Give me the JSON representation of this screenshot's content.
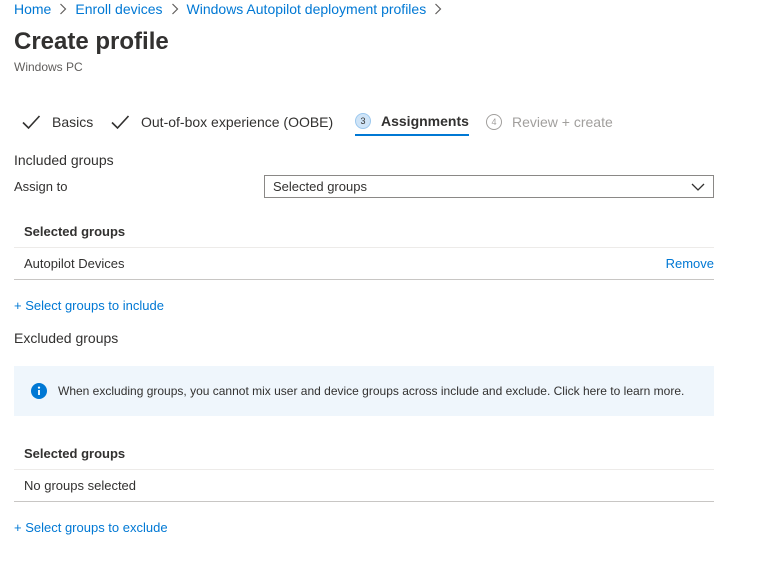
{
  "breadcrumb": [
    {
      "label": "Home"
    },
    {
      "label": "Enroll devices"
    },
    {
      "label": "Windows Autopilot deployment profiles"
    }
  ],
  "page": {
    "title": "Create profile",
    "subtitle": "Windows PC"
  },
  "wizard": {
    "steps": [
      {
        "label": "Basics",
        "state": "completed"
      },
      {
        "label": "Out-of-box experience (OOBE)",
        "state": "completed"
      },
      {
        "number": "3",
        "label": "Assignments",
        "state": "active"
      },
      {
        "number": "4",
        "label": "Review + create",
        "state": "disabled"
      }
    ]
  },
  "included": {
    "heading": "Included groups",
    "assign_label": "Assign to",
    "assign_value": "Selected groups",
    "table_header": "Selected groups",
    "rows": [
      {
        "name": "Autopilot Devices",
        "action": "Remove"
      }
    ],
    "add_link": "+ Select groups to include"
  },
  "excluded": {
    "heading": "Excluded groups",
    "info_text": "When excluding groups, you cannot mix user and device groups across include and exclude. Click here to learn more.",
    "table_header": "Selected groups",
    "empty_text": "No groups selected",
    "add_link": "+ Select groups to exclude"
  },
  "colors": {
    "accent": "#0078d4",
    "info_background": "#eff6fc",
    "text": "#323130",
    "disabled": "#a19f9d"
  },
  "icons": {
    "breadcrumb_separator": "chevron-right-icon",
    "completed_step": "checkmark-icon",
    "dropdown": "chevron-down-icon",
    "info": "info-icon"
  }
}
